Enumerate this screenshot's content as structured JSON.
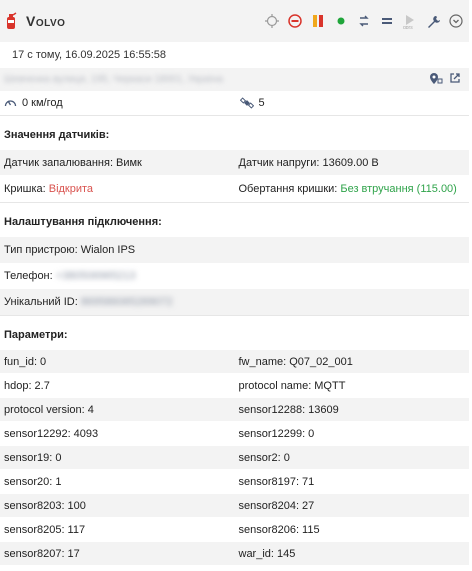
{
  "unit": {
    "name": "Volvo"
  },
  "timeline": {
    "text": "17 с тому, 16.09.2025 16:55:58"
  },
  "address": {
    "text": "Шевченка вулиця, 195, Черкаси 18001, Україна"
  },
  "stats": {
    "speed": "0 км/год",
    "satellites": "5"
  },
  "sensors": {
    "title": "Значення датчиків:",
    "ignition_key": "Датчик запалювання:",
    "ignition_value": "Вимк",
    "voltage_key": "Датчик напруги:",
    "voltage_value": "13609.00 В",
    "lid_key": "Кришка:",
    "lid_value": "Відкрита",
    "rotation_key": "Обертання кришки:",
    "rotation_value": "Без втручання (115.00)"
  },
  "connection": {
    "title": "Налаштування підключення:",
    "device_key": "Тип пристрою:",
    "device_value": "Wialon IPS",
    "phone_key": "Телефон:",
    "phone_value": "+380506965213",
    "uid_key": "Унікальний ID:",
    "uid_value": "869586065269072"
  },
  "params": {
    "title": "Параметри:",
    "rows": [
      [
        {
          "k": "fun_id:",
          "v": "0"
        },
        {
          "k": "fw_name:",
          "v": "Q07_02_001"
        }
      ],
      [
        {
          "k": "hdop:",
          "v": "2.7"
        },
        {
          "k": "protocol name:",
          "v": "MQTT"
        }
      ],
      [
        {
          "k": "protocol version:",
          "v": "4"
        },
        {
          "k": "sensor12288:",
          "v": "13609"
        }
      ],
      [
        {
          "k": "sensor12292:",
          "v": "4093"
        },
        {
          "k": "sensor12299:",
          "v": "0"
        }
      ],
      [
        {
          "k": "sensor19:",
          "v": "0"
        },
        {
          "k": "sensor2:",
          "v": "0"
        }
      ],
      [
        {
          "k": "sensor20:",
          "v": "1"
        },
        {
          "k": "sensor8197:",
          "v": "71"
        }
      ],
      [
        {
          "k": "sensor8203:",
          "v": "100"
        },
        {
          "k": "sensor8204:",
          "v": "27"
        }
      ],
      [
        {
          "k": "sensor8205:",
          "v": "117"
        },
        {
          "k": "sensor8206:",
          "v": "115"
        }
      ],
      [
        {
          "k": "sensor8207:",
          "v": "17"
        },
        {
          "k": "war_id:",
          "v": "145"
        }
      ]
    ]
  },
  "icons": {
    "unit": "fire-extinguisher-icon",
    "tools": [
      "locate-icon",
      "block-icon",
      "fuel-icon",
      "online-dot-icon",
      "switch-icon",
      "list-icon",
      "gprs-icon",
      "wrench-icon",
      "chevron-down-circle-icon"
    ],
    "address": [
      "geofence-icon",
      "open-external-icon"
    ],
    "speed": "speedometer-icon",
    "satellites": "satellite-icon"
  },
  "colors": {
    "accent_red": "#d9534f",
    "status_green": "#2fa34a",
    "row_gray": "#f3f3f3"
  }
}
